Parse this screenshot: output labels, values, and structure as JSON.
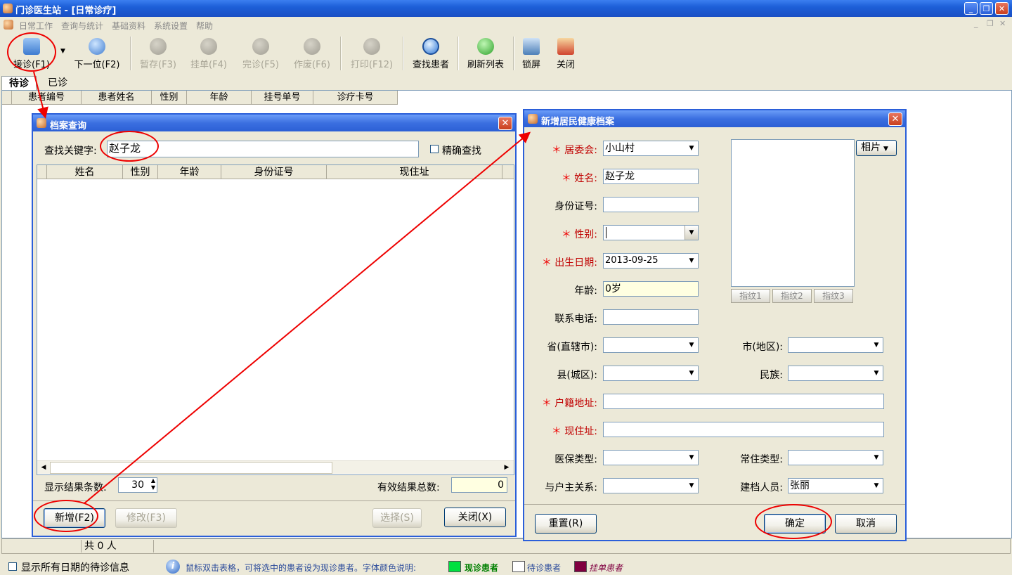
{
  "window": {
    "title": "门诊医生站 - [日常诊疗]"
  },
  "menu": [
    "日常工作",
    "查询与统计",
    "基础资料",
    "系统设置",
    "帮助"
  ],
  "toolbar": {
    "receive": "接诊(F1)",
    "next": "下一位(F2)",
    "hold": "暂存(F3)",
    "pend": "挂单(F4)",
    "finish": "完诊(F5)",
    "void": "作废(F6)",
    "print": "打印(F12)",
    "find_patient": "查找患者",
    "refresh": "刷新列表",
    "lock": "锁屏",
    "close": "关闭"
  },
  "tabs": [
    "待诊",
    "已诊"
  ],
  "main_columns": [
    "患者编号",
    "患者姓名",
    "性别",
    "年龄",
    "挂号单号",
    "诊疗卡号"
  ],
  "status": {
    "count": "共 0 人"
  },
  "bottom": {
    "show_all": "显示所有日期的待诊信息",
    "hint": "鼠标双击表格，可将选中的患者设为现诊患者。字体颜色说明:",
    "legend": [
      {
        "label": "现诊患者",
        "color": "#00c000"
      },
      {
        "label": "待诊患者",
        "color": "#ffffff"
      },
      {
        "label": "挂单患者",
        "color": "#800040"
      }
    ]
  },
  "search_dialog": {
    "title": "档案查询",
    "keyword_label": "查找关键字:",
    "keyword_value": "赵子龙",
    "exact_label": "精确查找",
    "columns": [
      "姓名",
      "性别",
      "年龄",
      "身份证号",
      "现住址"
    ],
    "rows_label": "显示结果条数:",
    "rows_value": "30",
    "total_label": "有效结果总数:",
    "total_value": "0",
    "add": "新增(F2)",
    "edit": "修改(F3)",
    "select": "选择(S)",
    "close": "关闭(X)"
  },
  "record_dialog": {
    "title": "新增居民健康档案",
    "committee_label": "居委会:",
    "committee_value": "小山村",
    "name_label": "姓名:",
    "name_value": "赵子龙",
    "id_label": "身份证号:",
    "id_value": "",
    "gender_label": "性别:",
    "gender_value": "",
    "birth_label": "出生日期:",
    "birth_value": "2013-09-25",
    "age_label": "年龄:",
    "age_value": "0岁",
    "phone_label": "联系电话:",
    "province_label": "省(直辖市):",
    "city_label": "市(地区):",
    "county_label": "县(城区):",
    "ethnic_label": "民族:",
    "domicile_label": "户籍地址:",
    "address_label": "现住址:",
    "insurance_label": "医保类型:",
    "resident_label": "常住类型:",
    "relation_label": "与户主关系:",
    "creator_label": "建档人员:",
    "creator_value": "张丽",
    "photo_button": "相片",
    "fingerprints": [
      "指纹1",
      "指纹2",
      "指纹3"
    ],
    "reset": "重置(R)",
    "ok": "确定",
    "cancel": "取消"
  }
}
